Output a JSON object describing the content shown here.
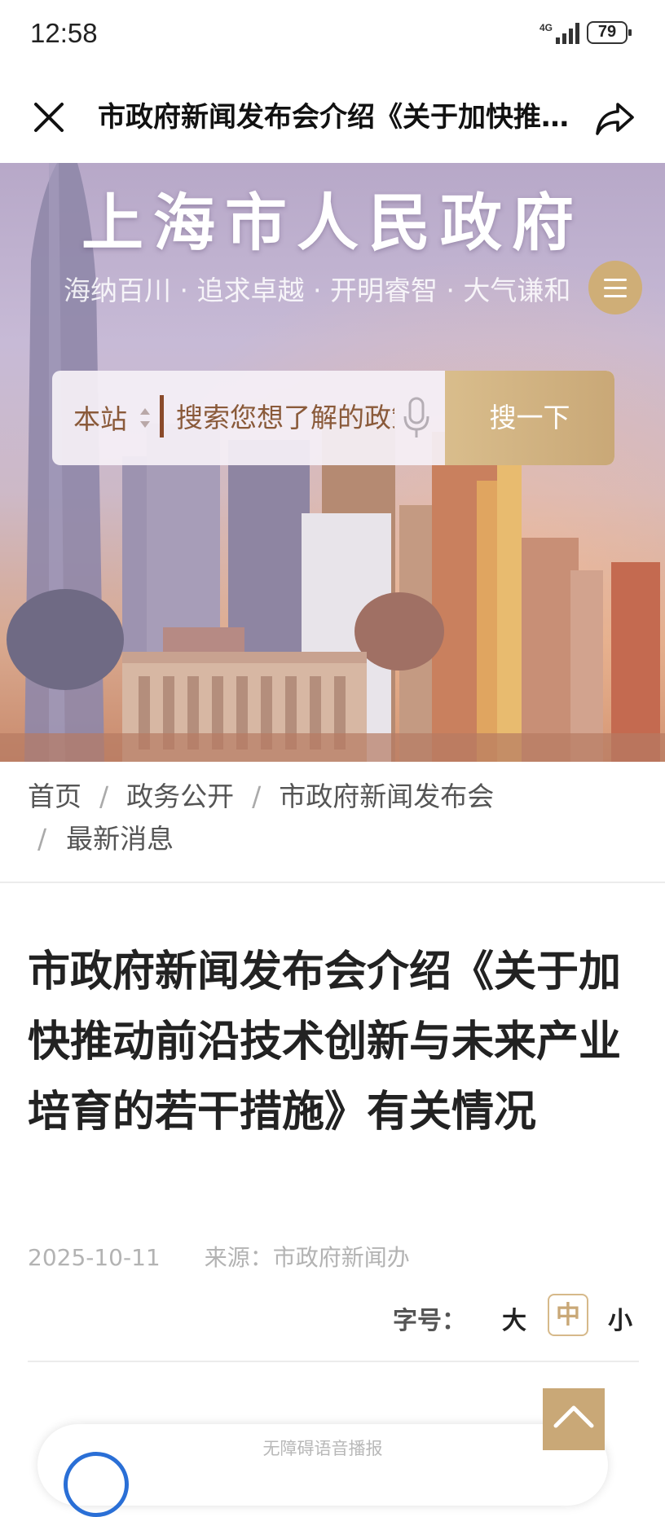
{
  "status_bar": {
    "time": "12:58",
    "network": "4G",
    "battery": "79"
  },
  "nav": {
    "title": "市政府新闻发布会介绍《关于加快推动前沿技术创新与未来产业培育的若干措施》有关情况"
  },
  "hero": {
    "site_title": "上海市人民政府",
    "slogan": "海纳百川 · 追求卓越 · 开明睿智 · 大气谦和",
    "search": {
      "scope": "本站",
      "placeholder": "搜索您想了解的政策",
      "button": "搜一下"
    }
  },
  "breadcrumb": {
    "items": [
      "首页",
      "政务公开",
      "市政府新闻发布会",
      "最新消息"
    ],
    "separator": "/"
  },
  "article": {
    "title": "市政府新闻发布会介绍《关于加快推动前沿技术创新与未来产业培育的若干措施》有关情况",
    "date": "2025-10-11",
    "source": "来源：市政府新闻办",
    "font_size": {
      "label": "字号：",
      "large": "大",
      "medium": "中",
      "small": "小",
      "selected": "中"
    }
  },
  "audio": {
    "label": "无障碍语音播报"
  },
  "colors": {
    "accent_gold": "#c9a877",
    "title_text": "#222222",
    "meta_text": "#b3b3b3"
  }
}
